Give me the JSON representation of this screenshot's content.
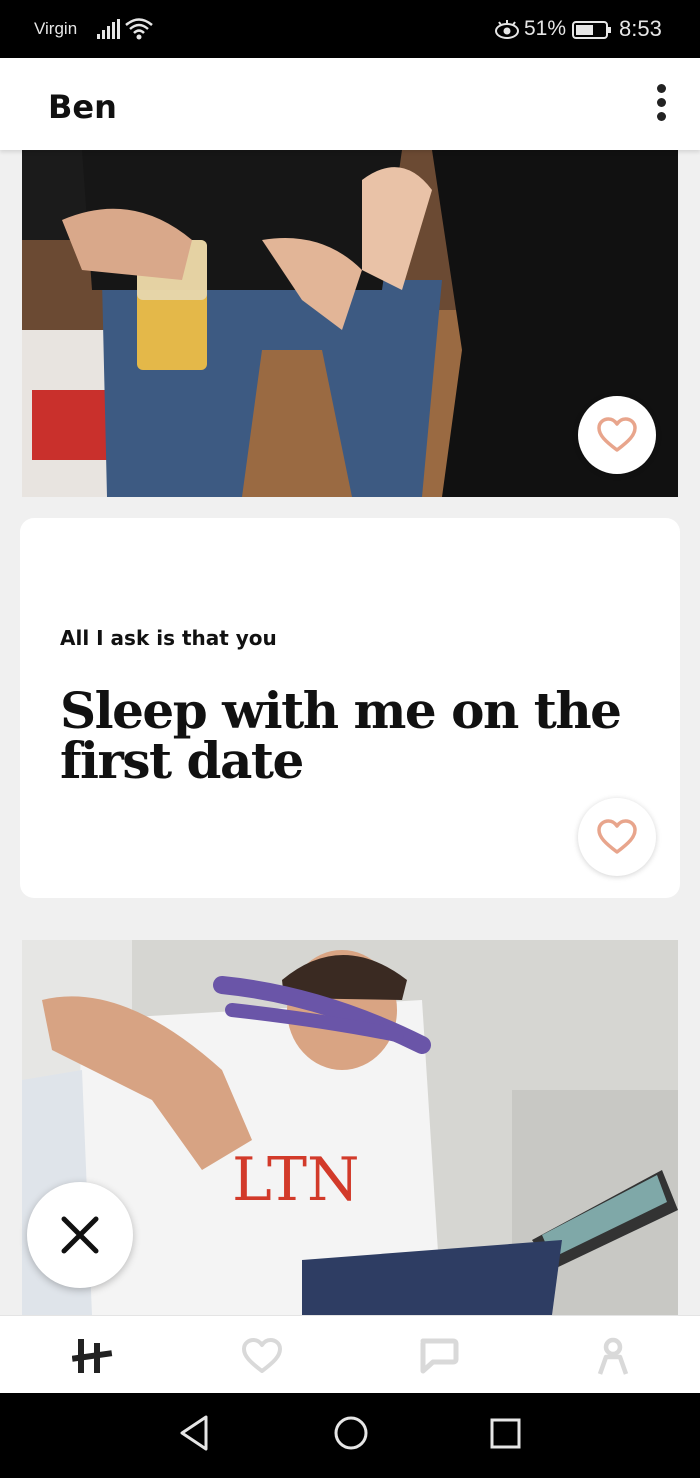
{
  "status_bar": {
    "carrier": "Virgin",
    "battery_percent": "51%",
    "time": "8:53"
  },
  "header": {
    "title": "Ben",
    "menu_icon": "more-vertical-icon"
  },
  "profile": {
    "photos": [
      {
        "description_icon": "photo",
        "like_icon": "heart-outline-icon"
      },
      {
        "description_icon": "photo",
        "skip_icon": "close-icon"
      }
    ],
    "prompt": {
      "question": "All I ask is that you",
      "answer": "Sleep with me on the first date",
      "like_icon": "heart-outline-icon"
    }
  },
  "bottom_nav": {
    "items": [
      {
        "icon": "hinge-logo-icon",
        "active": true
      },
      {
        "icon": "heart-icon",
        "active": false
      },
      {
        "icon": "chat-icon",
        "active": false
      },
      {
        "icon": "profile-icon",
        "active": false
      }
    ]
  },
  "system_nav": {
    "buttons": [
      "back-icon",
      "home-icon",
      "recents-icon"
    ]
  },
  "colors": {
    "like_accent": "#e8a58c",
    "background": "#f0f0f0",
    "nav_inactive": "#d9d9d9",
    "nav_active": "#222222"
  }
}
